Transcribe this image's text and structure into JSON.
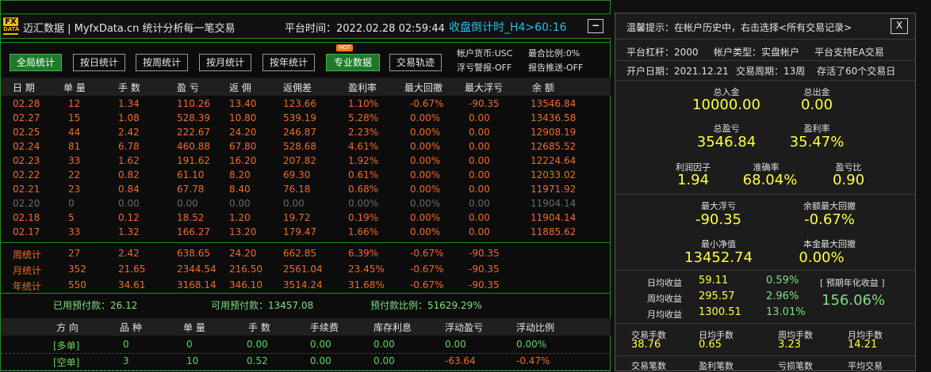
{
  "header": {
    "logo_top": "FX",
    "logo_bottom": "DATA",
    "brand": "迈汇数据 | MyfxData.cn  统计分析每一笔交易",
    "platform_time": "平台时间：2022.02.28 02:59:44",
    "countdown": "收盘倒计时_H4>60:16",
    "minimize": "−"
  },
  "toolbar": {
    "buttons": [
      "全局统计",
      "按日统计",
      "按周统计",
      "按月统计",
      "按年统计",
      "专业数据",
      "交易轨迹"
    ],
    "hot_badge": "HOT",
    "info": [
      "帐户货币:USC",
      "最合比例:0%",
      "浮亏警报-OFF",
      "报告推送-OFF"
    ]
  },
  "table": {
    "headers": [
      "日 期",
      "单 量",
      "手 数",
      "盈 亏",
      "返 佣",
      "返佣差",
      "盈利率",
      "最大回撤",
      "最大浮亏",
      "余 额"
    ],
    "rows": [
      [
        "02.28",
        "12",
        "1.34",
        "110.26",
        "13.40",
        "123.66",
        "1.10%",
        "-0.67%",
        "-90.35",
        "13546.84"
      ],
      [
        "02.27",
        "15",
        "1.08",
        "528.39",
        "10.80",
        "539.19",
        "5.28%",
        "0.00%",
        "0.00",
        "13436.58"
      ],
      [
        "02.25",
        "44",
        "2.42",
        "222.67",
        "24.20",
        "246.87",
        "2.23%",
        "0.00%",
        "0.00",
        "12908.19"
      ],
      [
        "02.24",
        "81",
        "6.78",
        "460.88",
        "67.80",
        "528.68",
        "4.61%",
        "0.00%",
        "0.00",
        "12685.52"
      ],
      [
        "02.23",
        "33",
        "1.62",
        "191.62",
        "16.20",
        "207.82",
        "1.92%",
        "0.00%",
        "0.00",
        "12224.64"
      ],
      [
        "02.22",
        "22",
        "0.82",
        "61.10",
        "8.20",
        "69.30",
        "0.61%",
        "0.00%",
        "0.00",
        "12033.02"
      ],
      [
        "02.21",
        "23",
        "0.84",
        "67.78",
        "8.40",
        "76.18",
        "0.68%",
        "0.00%",
        "0.00",
        "11971.92"
      ],
      [
        "02.20",
        "0",
        "0.00",
        "0.00",
        "0.00",
        "0.00",
        "0.00%",
        "0.00%",
        "0.00",
        "11904.14"
      ],
      [
        "02.18",
        "5",
        "0.12",
        "18.52",
        "1.20",
        "19.72",
        "0.19%",
        "0.00%",
        "0.00",
        "11904.14"
      ],
      [
        "02.17",
        "33",
        "1.32",
        "166.27",
        "13.20",
        "179.47",
        "1.66%",
        "0.00%",
        "0.00",
        "11885.62"
      ]
    ],
    "summary": [
      [
        "周统计",
        "27",
        "2.42",
        "638.65",
        "24.20",
        "662.85",
        "6.39%",
        "-0.67%",
        "-90.35"
      ],
      [
        "月统计",
        "352",
        "21.65",
        "2344.54",
        "216.50",
        "2561.04",
        "23.45%",
        "-0.67%",
        "-90.35"
      ],
      [
        "年统计",
        "550",
        "34.61",
        "3168.14",
        "346.10",
        "3514.24",
        "31.68%",
        "-0.67%",
        "-90.35"
      ]
    ]
  },
  "advance": {
    "used": "已用预付款：26.12",
    "available": "可用预付款：13457.08",
    "ratio": "预付款比例：51629.29%"
  },
  "positions": {
    "headers": [
      "方 向",
      "品 种",
      "单 量",
      "手 数",
      "手续费",
      "库存利息",
      "浮动盈亏",
      "浮动比例"
    ],
    "rows": [
      [
        "[多单]",
        "0",
        "0",
        "0.00",
        "0.00",
        "0.00",
        "0.00",
        "0.00%"
      ],
      [
        "[空单]",
        "3",
        "10",
        "0.52",
        "0.00",
        "0.00",
        "-63.64",
        "-0.47%"
      ]
    ]
  },
  "panel": {
    "tip": "温馨提示：在帐户历史中，右击选择<所有交易记录>",
    "close": "X",
    "leverage": "平台杠杆：2000",
    "account_type": "帐户类型：实盘帐户",
    "ea": "平台支持EA交易",
    "open_date": "开户日期：2021.12.21",
    "period": "交易周期：13周",
    "survived": "存活了60个交易日",
    "deposit_label": "总入金",
    "deposit": "10000.00",
    "withdraw_label": "总出金",
    "withdraw": "0.00",
    "profit_label": "总盈亏",
    "profit": "3546.84",
    "profit_rate_label": "盈利率",
    "profit_rate": "35.47%",
    "pf_label": "利润因子",
    "pf": "1.94",
    "acc_label": "准确率",
    "acc": "68.04%",
    "pl_ratio_label": "盈亏比",
    "pl_ratio": "0.90",
    "max_float_label": "最大浮亏",
    "max_float": "-90.35",
    "max_dd_label": "余额最大回撤",
    "max_dd": "-0.67%",
    "min_equity_label": "最小净值",
    "min_equity": "13452.74",
    "principal_dd_label": "本金最大回撤",
    "principal_dd": "0.00%",
    "daily_label": "日均收益",
    "daily": "59.11",
    "daily_pct": "0.59%",
    "weekly_label": "周均收益",
    "weekly": "295.57",
    "weekly_pct": "2.96%",
    "monthly_label": "月均收益",
    "monthly": "1300.51",
    "monthly_pct": "13.01%",
    "annual_label": "[ 预期年化收益 ]",
    "annual": "156.06%",
    "trade_lots_label": "交易手数",
    "trade_lots": "38.76",
    "daily_lots_label": "日均手数",
    "daily_lots": "0.65",
    "weekly_lots_label": "周均手数",
    "weekly_lots": "3.23",
    "monthly_lots_label": "月均手数",
    "monthly_lots": "14.21",
    "bottom_labels": [
      "交易笔数",
      "盈利笔数",
      "亏损笔数",
      "平均交易"
    ]
  }
}
